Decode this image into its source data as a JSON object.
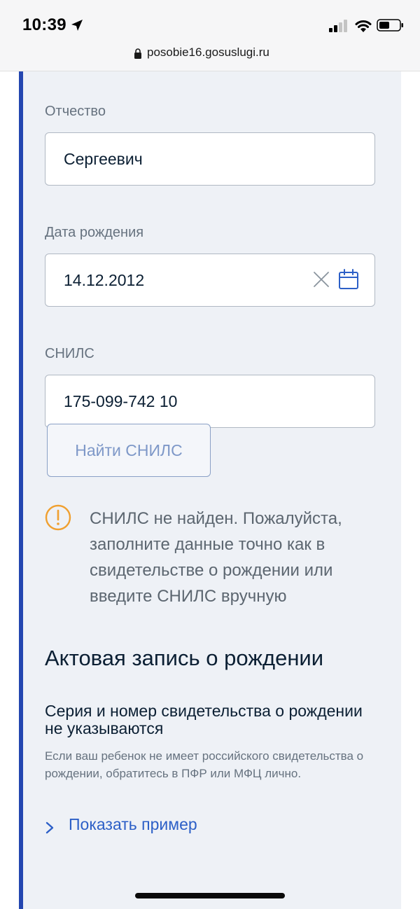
{
  "status_bar": {
    "time": "10:39",
    "icons": [
      "location-arrow-icon",
      "cellular-signal-icon",
      "wifi-icon",
      "battery-icon"
    ]
  },
  "browser": {
    "url": "posobie16.gosuslugi.ru"
  },
  "form": {
    "patronymic": {
      "label": "Отчество",
      "value": "Сергеевич"
    },
    "birth_date": {
      "label": "Дата рождения",
      "value": "14.12.2012"
    },
    "snils": {
      "label": "СНИЛС",
      "value": "175-099-742 10"
    },
    "find_button_label": "Найти СНИЛС",
    "warning_text": "СНИЛС не найден. Пожалуйста, заполните данные точно как в свидетельстве о рождении или введите СНИЛС вручную"
  },
  "birth_record": {
    "title": "Актовая запись о рождении",
    "subtitle": "Серия и номер свидетельства о рождении не указываются",
    "hint": "Если ваш ребенок не имеет российского свидетельства о рождении, обратитесь в ПФР или МФЦ лично.",
    "show_example_link": "Показать пример"
  },
  "colors": {
    "accent": "#2446b0",
    "card_background": "#eef1f6",
    "warning": "#f0a030",
    "link": "#2c5fc7"
  }
}
